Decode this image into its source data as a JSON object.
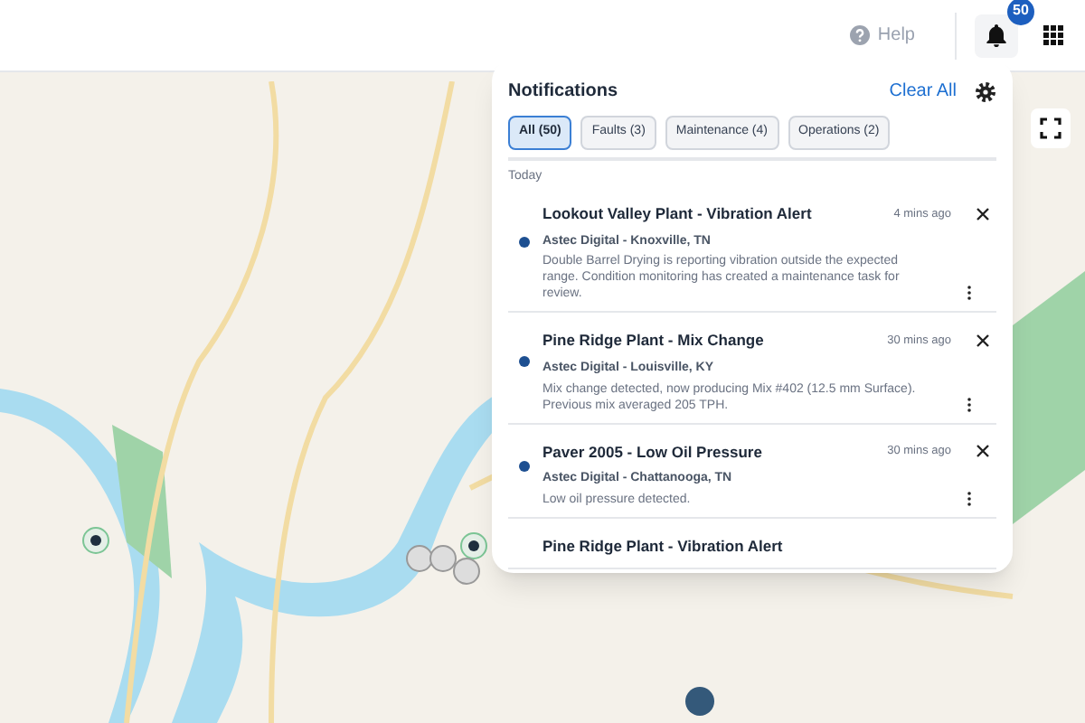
{
  "header": {
    "help": "Help",
    "notification_count": "50"
  },
  "notifications": {
    "title": "Notifications",
    "clear_all": "Clear All",
    "filters": [
      {
        "label": "All (50)",
        "selected": true
      },
      {
        "label": "Faults (3)",
        "selected": false
      },
      {
        "label": "Maintenance (4)",
        "selected": false
      },
      {
        "label": "Operations (2)",
        "selected": false
      }
    ],
    "section": "Today",
    "items": [
      {
        "title": "Lookout Valley Plant - Vibration Alert",
        "time": "4 mins ago",
        "source": "Astec Digital - Knoxville, TN",
        "message": "Double Barrel Drying is reporting vibration outside the expected range. Condition monitoring has created a maintenance task for review.",
        "unread": true
      },
      {
        "title": "Pine Ridge Plant - Mix Change",
        "time": "30 mins ago",
        "source": "Astec Digital - Louisville, KY",
        "message": "Mix change detected, now producing Mix #402 (12.5 mm Surface). Previous mix averaged 205 TPH.",
        "unread": true
      },
      {
        "title": "Paver 2005 - Low Oil Pressure",
        "time": "30 mins ago",
        "source": "Astec Digital - Chattanooga, TN",
        "message": "Low oil pressure detected.",
        "unread": true
      },
      {
        "title": "Pine Ridge Plant - Vibration Alert"
      }
    ]
  }
}
